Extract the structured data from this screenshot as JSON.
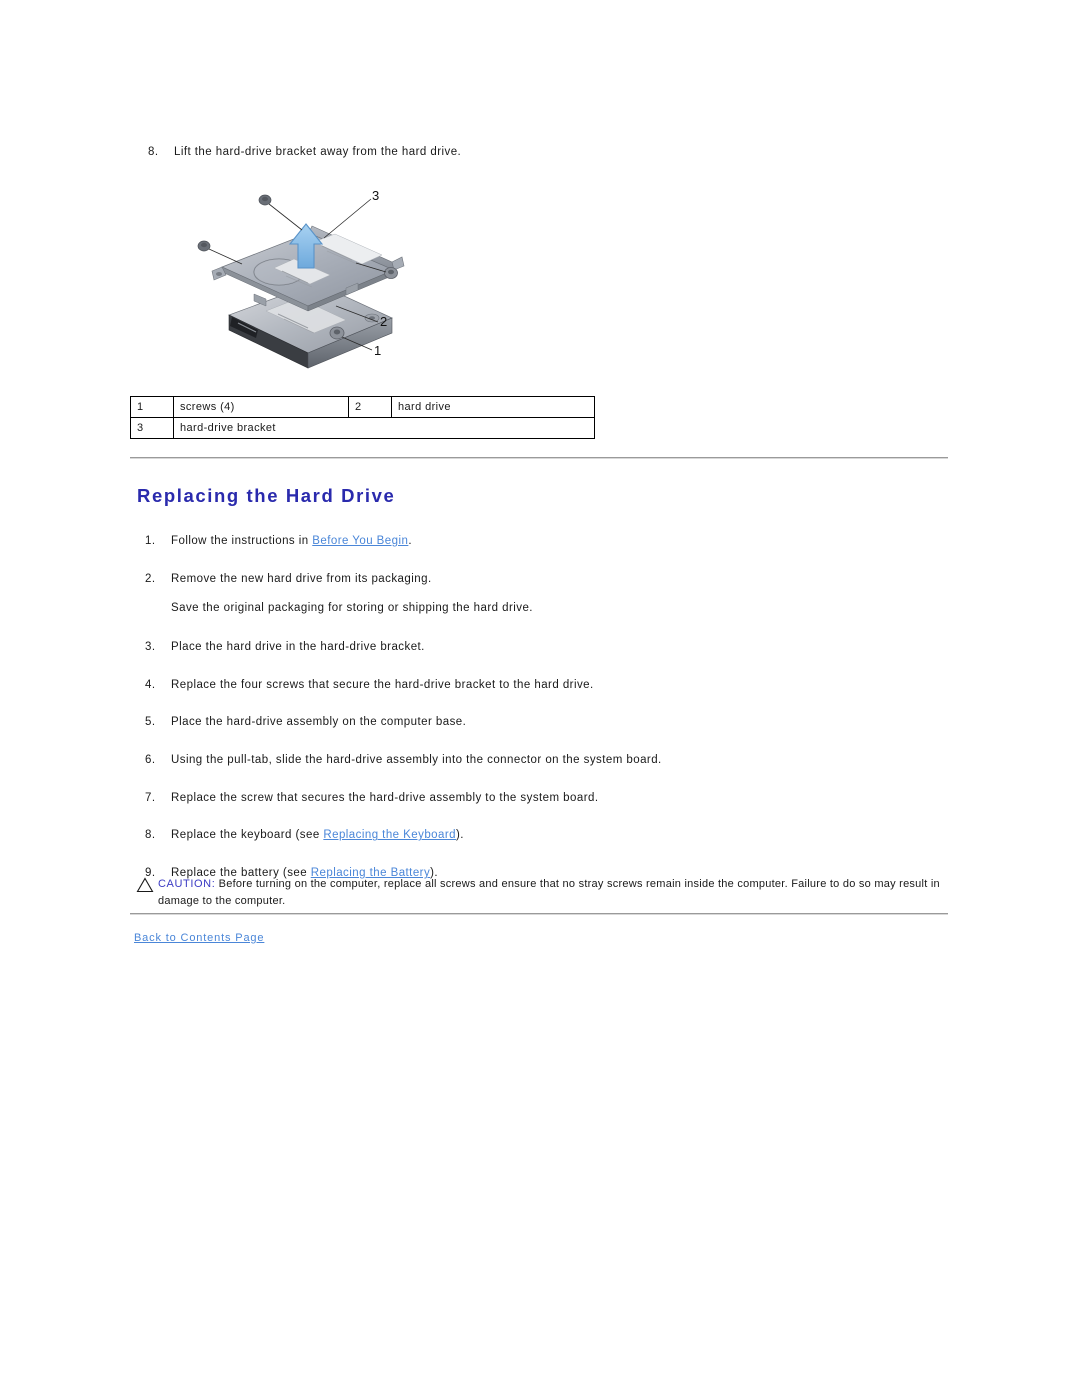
{
  "top_step": {
    "number": "8.",
    "text": "Lift the hard-drive bracket away from the hard drive."
  },
  "figure": {
    "name": "hard-drive-bracket-exploded-view",
    "callout_labels": [
      "3",
      "2",
      "1"
    ]
  },
  "callout_table": {
    "rows": [
      {
        "num1": "1",
        "label1": "screws (4)",
        "num2": "2",
        "label2": "hard drive"
      },
      {
        "num1": "3",
        "label1": "hard-drive bracket"
      }
    ]
  },
  "section": {
    "heading": "Replacing the Hard Drive"
  },
  "steps": [
    {
      "number": "1.",
      "pre": "Follow the instructions in ",
      "link": "Before You Begin",
      "post": "."
    },
    {
      "number": "2.",
      "pre": "Remove the new hard drive from its packaging.",
      "link": "",
      "post": "",
      "note": "Save the original packaging for storing or shipping the hard drive."
    },
    {
      "number": "3.",
      "pre": "Place the hard drive in the hard-drive bracket.",
      "link": "",
      "post": ""
    },
    {
      "number": "4.",
      "pre": "Replace the four screws that secure the hard-drive bracket to the hard drive.",
      "link": "",
      "post": ""
    },
    {
      "number": "5.",
      "pre": "Place the hard-drive assembly on the computer base.",
      "link": "",
      "post": ""
    },
    {
      "number": "6.",
      "pre": "Using the pull-tab, slide the hard-drive assembly into the connector on the system board.",
      "link": "",
      "post": ""
    },
    {
      "number": "7.",
      "pre": "Replace the screw that secures the hard-drive assembly to the system board.",
      "link": "",
      "post": ""
    },
    {
      "number": "8.",
      "pre": "Replace the keyboard (see ",
      "link": "Replacing the Keyboard",
      "post": ")."
    },
    {
      "number": "9.",
      "pre": "Replace the battery (see ",
      "link": "Replacing the Battery",
      "post": ")."
    }
  ],
  "caution": {
    "label": "CAUTION:",
    "text": " Before turning on the computer, replace all screws and ensure that no stray screws remain inside the computer. Failure to do so may result in damage to the computer."
  },
  "footer": {
    "back_link": "Back to Contents Page"
  },
  "colors": {
    "heading": "#2a2aad",
    "link": "#4a86d8",
    "caution_label": "#3b3bc4",
    "rule": "#9a9a9a",
    "arrow": "#7fb5e6"
  }
}
